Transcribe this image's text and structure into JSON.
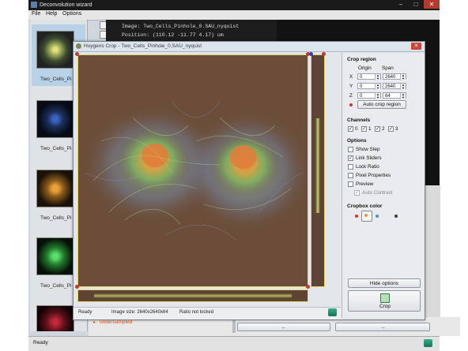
{
  "wizard": {
    "title": "Deconvolution wizard",
    "menu": [
      "File",
      "Help",
      "Options"
    ],
    "info_lines": [
      "Image: Two_Cells_Pinhole_0.SAU_nyquist",
      "Position: (110.12 -11.77 4.17) um"
    ],
    "thumbnails": [
      "Two_Cells_Pi",
      "Two_Cells_Pi",
      "Two_Cells_Pi",
      "Two_Cells_Pi"
    ],
    "warning_text": "undersampled",
    "status": "Ready",
    "colors": {
      "title_bar": "#1a1a1a",
      "thumb_panel": "#dfe3e6"
    }
  },
  "crop": {
    "title": "Huygens Crop - Two_Cells_Pinhole_0.SAU_nyquist",
    "status": {
      "ready": "Ready",
      "image_size": "Image size: 2640x2640x64",
      "ratio": "Ratio not locked"
    },
    "crop_region": {
      "heading": "Crop region",
      "origin_label": "Origin",
      "span_label": "Span",
      "rows": [
        {
          "axis": "X",
          "origin": "0",
          "span": "2640"
        },
        {
          "axis": "Y",
          "origin": "0",
          "span": "2640"
        },
        {
          "axis": "Z",
          "origin": "0",
          "span": "64"
        }
      ],
      "auto_button": "Auto crop region"
    },
    "channels": {
      "heading": "Channels",
      "items": [
        "0",
        "1",
        "2",
        "3"
      ]
    },
    "options": {
      "heading": "Options",
      "items": [
        {
          "label": "Show Step",
          "checked": false
        },
        {
          "label": "Link Sliders",
          "checked": true
        },
        {
          "label": "Lock Ratio",
          "checked": false
        },
        {
          "label": "Pixel Properties",
          "checked": false
        },
        {
          "label": "Preview",
          "checked": false
        },
        {
          "label": "Auto Contrast",
          "checked": true,
          "disabled": true
        }
      ]
    },
    "cropbox_color": {
      "heading": "Cropbox color",
      "selected": "#d9a23a"
    },
    "hide_button": "Hide options",
    "crop_button": "Crop"
  }
}
